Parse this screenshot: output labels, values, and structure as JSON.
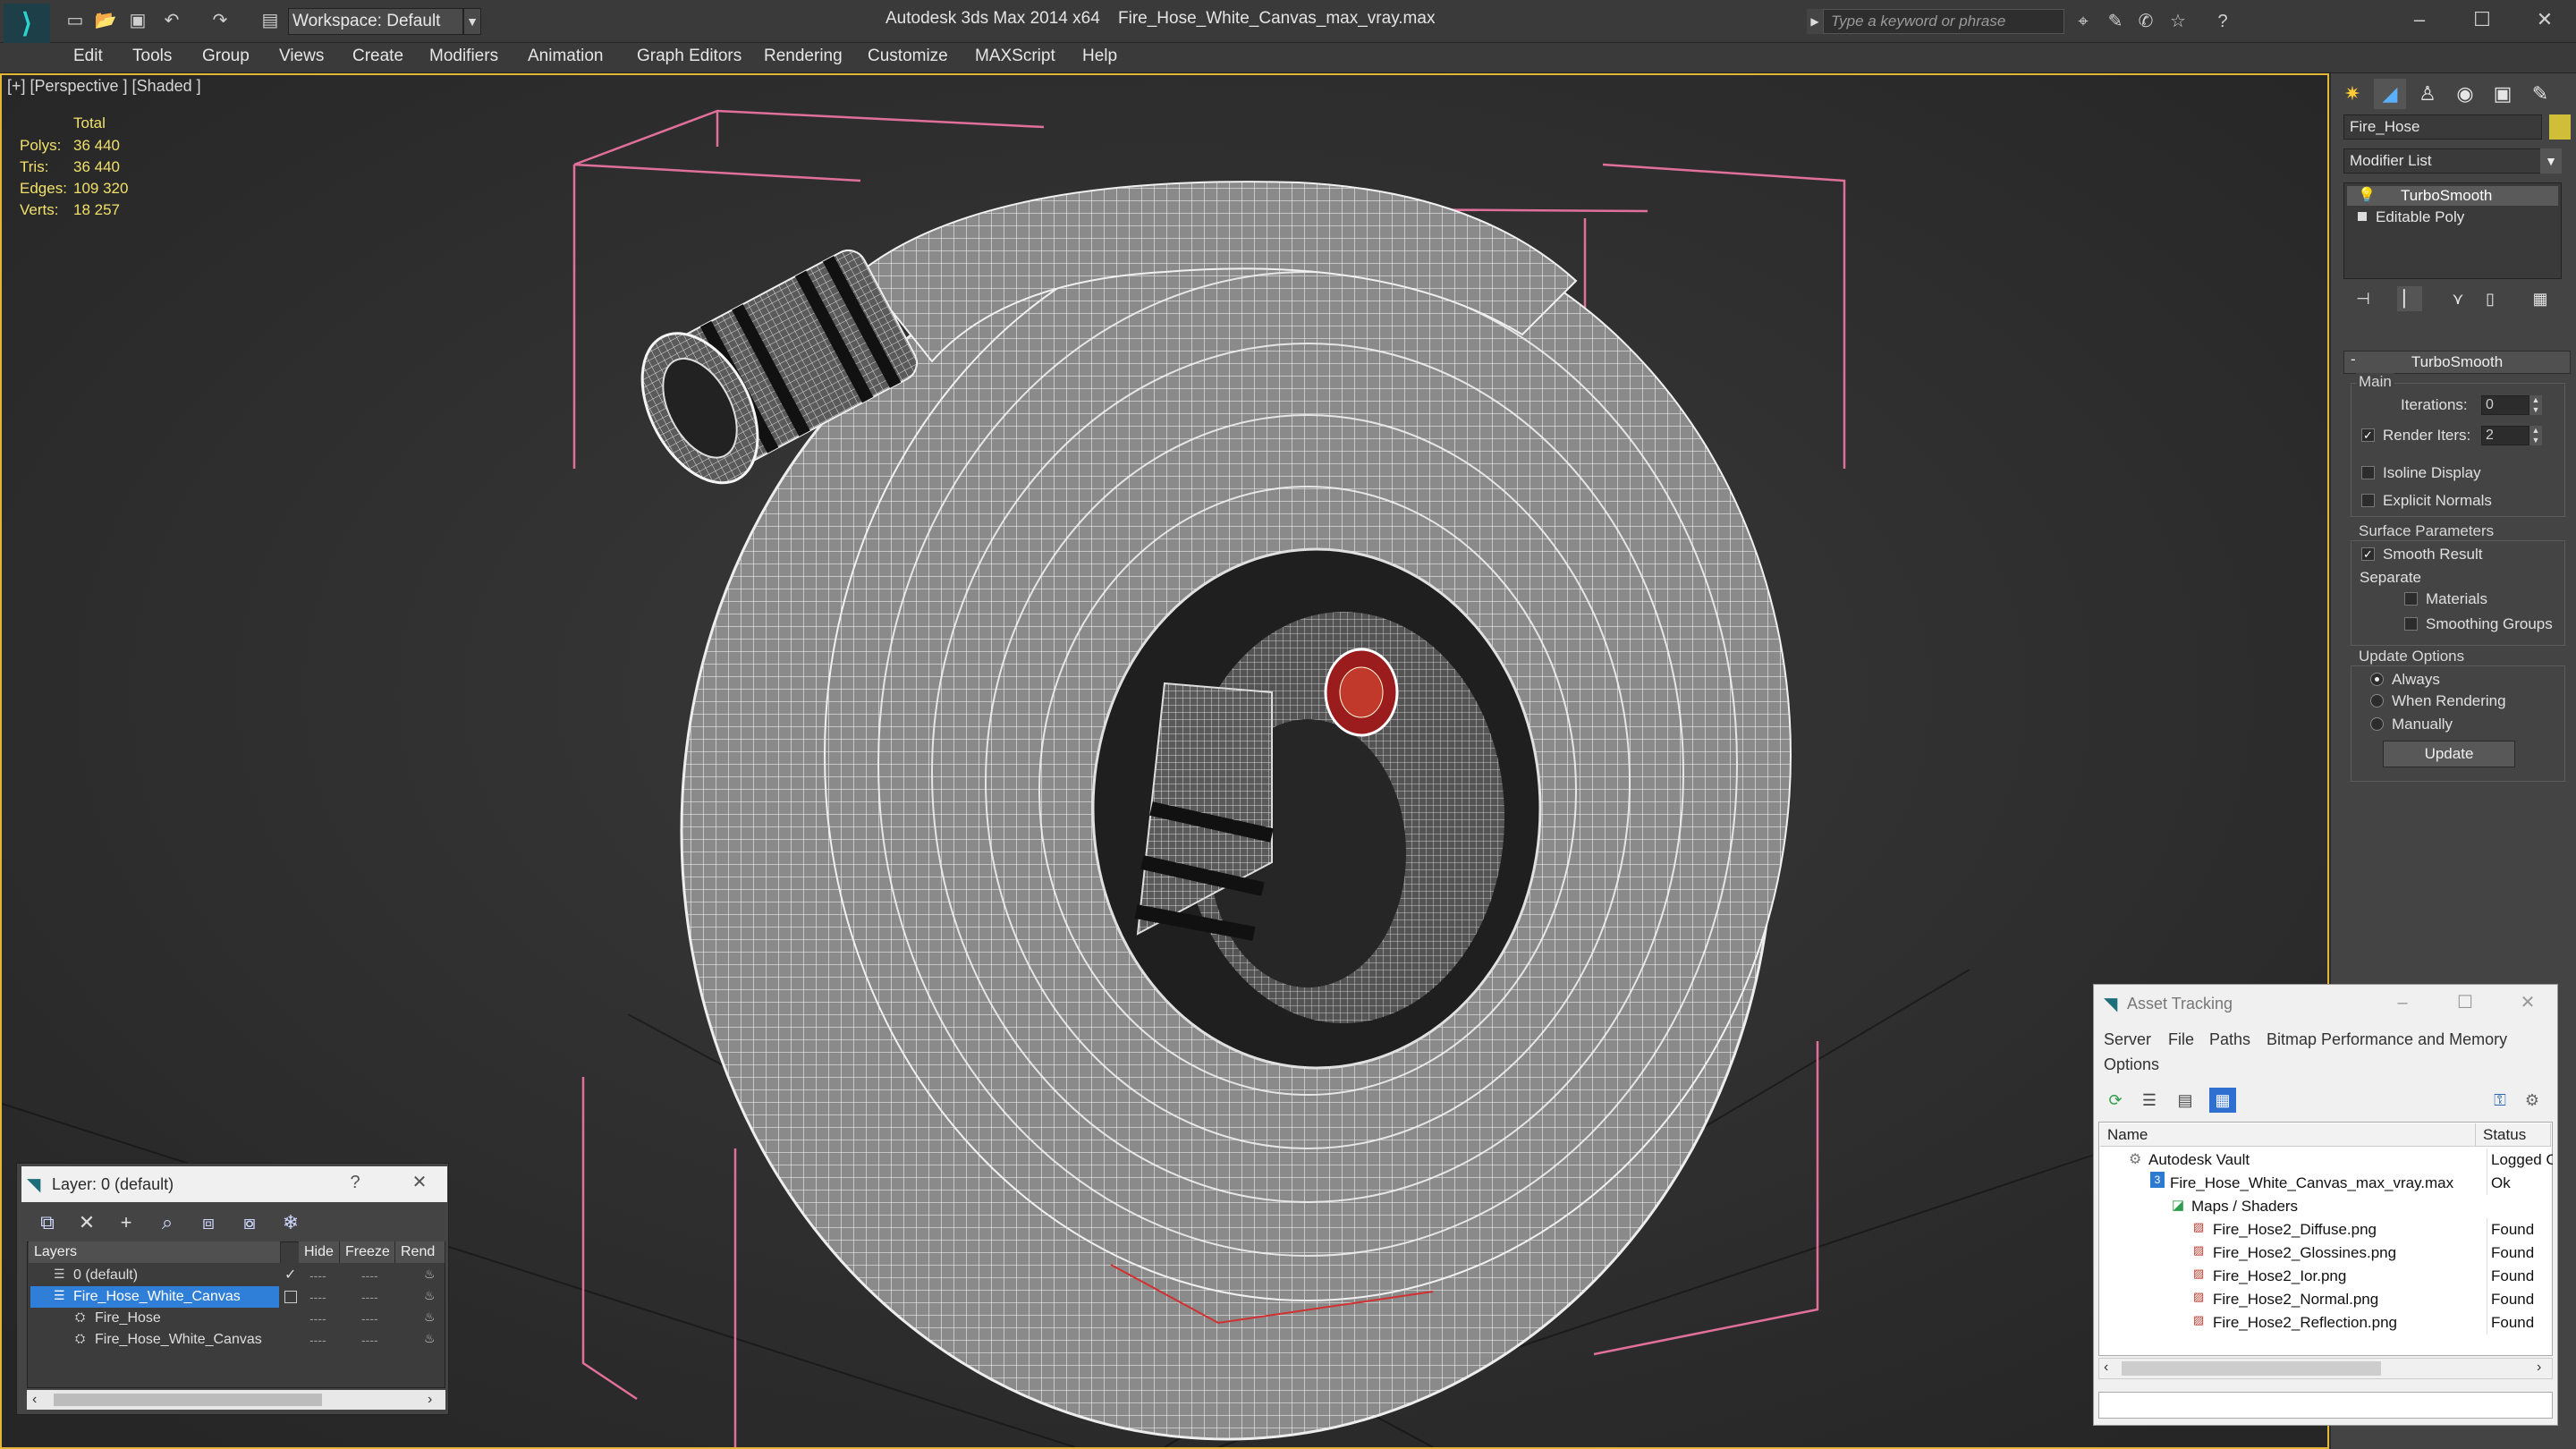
{
  "titlebar": {
    "workspace_label": "Workspace: Default",
    "app_name": "Autodesk 3ds Max  2014 x64",
    "file_name": "Fire_Hose_White_Canvas_max_vray.max",
    "search_placeholder": "Type a keyword or phrase"
  },
  "menu": [
    "Edit",
    "Tools",
    "Group",
    "Views",
    "Create",
    "Modifiers",
    "Animation",
    "Graph Editors",
    "Rendering",
    "Customize",
    "MAXScript",
    "Help"
  ],
  "viewport": {
    "label": "[+] [Perspective ] [Shaded ]",
    "stats": {
      "header": "Total",
      "rows": [
        {
          "label": "Polys:",
          "value": "36 440"
        },
        {
          "label": "Tris:",
          "value": "36 440"
        },
        {
          "label": "Edges:",
          "value": "109 320"
        },
        {
          "label": "Verts:",
          "value": "18 257"
        }
      ]
    }
  },
  "command_panel": {
    "object_name": "Fire_Hose",
    "object_color": "#d0bd38",
    "modifier_list": "Modifier List",
    "stack": [
      "TurboSmooth",
      "Editable Poly"
    ],
    "rollout_title": "TurboSmooth",
    "main_group": "Main",
    "iterations_label": "Iterations:",
    "iterations_value": "0",
    "render_iters_label": "Render Iters:",
    "render_iters_value": "2",
    "isoline_label": "Isoline Display",
    "explicit_label": "Explicit Normals",
    "surface_group": "Surface Parameters",
    "smooth_label": "Smooth Result",
    "separate_label": "Separate",
    "materials_label": "Materials",
    "smoothing_groups_label": "Smoothing Groups",
    "update_group": "Update Options",
    "always_label": "Always",
    "when_rendering_label": "When Rendering",
    "manually_label": "Manually",
    "update_button": "Update"
  },
  "layer_dialog": {
    "title": "Layer: 0 (default)",
    "help": "?",
    "columns": [
      "Layers",
      "Hide",
      "Freeze",
      "Rend"
    ],
    "rows": [
      {
        "name": "0 (default)"
      },
      {
        "name": "Fire_Hose_White_Canvas"
      },
      {
        "name": "Fire_Hose"
      },
      {
        "name": "Fire_Hose_White_Canvas"
      }
    ],
    "dots": "----"
  },
  "asset_tracking": {
    "title": "Asset Tracking",
    "menu": [
      "Server",
      "File",
      "Paths",
      "Bitmap Performance and Memory",
      "Options"
    ],
    "columns": [
      "Name",
      "Status"
    ],
    "rows": [
      {
        "name": "Autodesk Vault",
        "status": "Logged Out"
      },
      {
        "name": "Fire_Hose_White_Canvas_max_vray.max",
        "status": "Ok"
      },
      {
        "name": "Maps / Shaders",
        "status": ""
      },
      {
        "name": "Fire_Hose2_Diffuse.png",
        "status": "Found"
      },
      {
        "name": "Fire_Hose2_Glossines.png",
        "status": "Found"
      },
      {
        "name": "Fire_Hose2_Ior.png",
        "status": "Found"
      },
      {
        "name": "Fire_Hose2_Normal.png",
        "status": "Found"
      },
      {
        "name": "Fire_Hose2_Reflection.png",
        "status": "Found"
      }
    ]
  }
}
